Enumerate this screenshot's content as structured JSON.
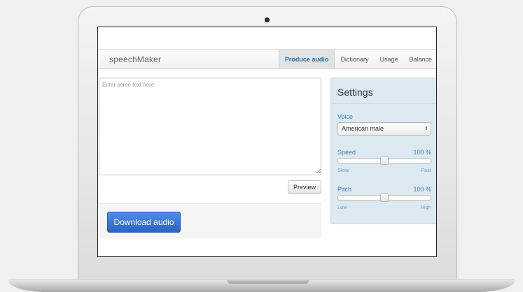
{
  "app": {
    "brand": "speechMaker"
  },
  "nav": {
    "tabs": [
      {
        "label": "Produce audio",
        "active": true
      },
      {
        "label": "Dictionary",
        "active": false
      },
      {
        "label": "Usage",
        "active": false
      },
      {
        "label": "Balance",
        "active": false
      }
    ]
  },
  "editor": {
    "placeholder": "Enter some text here",
    "value": "",
    "preview_label": "Preview",
    "download_label": "Download audio"
  },
  "settings": {
    "title": "Settings",
    "voice": {
      "label": "Voice",
      "selected": "American male"
    },
    "speed": {
      "label": "Speed",
      "value_text": "100 %",
      "value": 0.5,
      "min_label": "Slow",
      "max_label": "Fast"
    },
    "pitch": {
      "label": "Pitch",
      "value_text": "100 %",
      "value": 0.5,
      "min_label": "Low",
      "max_label": "High"
    }
  },
  "colors": {
    "accent": "#1f6fb2",
    "primary_button": "#2f6bcc",
    "settings_bg": "#dde9f1",
    "label": "#3d7fb6"
  }
}
